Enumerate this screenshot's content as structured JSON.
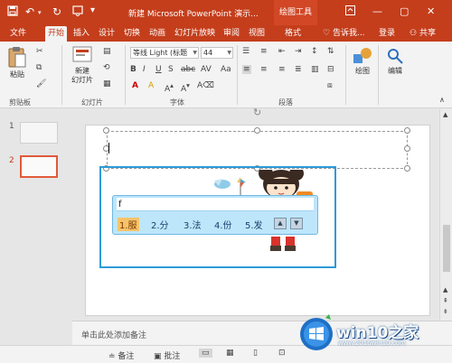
{
  "titlebar": {
    "title": "新建 Microsoft PowerPoint 演示...",
    "context_tab": "绘图工具"
  },
  "tabs": [
    {
      "label": "文件",
      "active": false
    },
    {
      "label": "开始",
      "active": true
    },
    {
      "label": "插入",
      "active": false
    },
    {
      "label": "设计",
      "active": false
    },
    {
      "label": "切换",
      "active": false
    },
    {
      "label": "动画",
      "active": false
    },
    {
      "label": "幻灯片放映",
      "active": false
    },
    {
      "label": "审阅",
      "active": false
    },
    {
      "label": "视图",
      "active": false
    },
    {
      "label": "格式",
      "active": false
    }
  ],
  "tell_me": "告诉我...",
  "login": "登录",
  "share": "共享",
  "ribbon": {
    "clipboard": {
      "paste": "粘贴",
      "label": "剪贴板"
    },
    "slides": {
      "new_slide_line1": "新建",
      "new_slide_line2": "幻灯片",
      "label": "幻灯片"
    },
    "font": {
      "font_name": "等线 Light (标题",
      "font_size": "44",
      "label": "字体"
    },
    "paragraph": {
      "label": "段落"
    },
    "drawing": {
      "label": "绘图"
    },
    "editing": {
      "label": "编辑"
    }
  },
  "thumbnails": [
    {
      "number": "1",
      "selected": false
    },
    {
      "number": "2",
      "selected": true
    }
  ],
  "ime": {
    "input": "f",
    "candidates": [
      "1.服",
      "2.分",
      "3.法",
      "4.份",
      "5.发"
    ],
    "selected_index": 0
  },
  "notes_placeholder": "单击此处添加备注",
  "statusbar": {
    "notes": "备注",
    "comments": "批注"
  },
  "watermark": {
    "brand": "win10之家",
    "url": "www.2016win10.com"
  },
  "colors": {
    "accent": "#c43e1c",
    "ime_border": "#2e9bd7"
  }
}
